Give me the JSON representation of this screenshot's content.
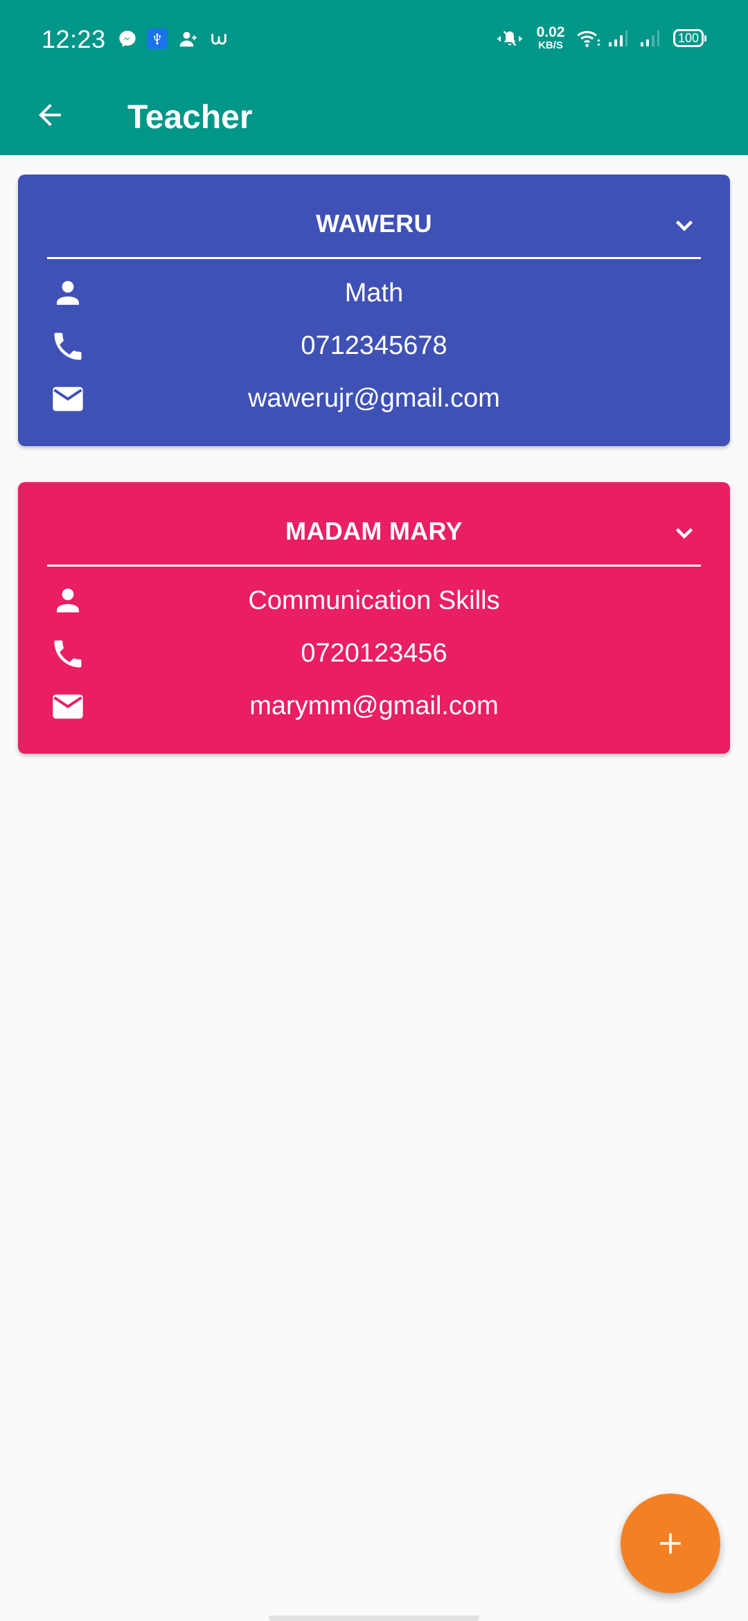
{
  "status_bar": {
    "time": "12:23",
    "notification_icons": [
      "messenger-icon",
      "usb-icon",
      "add-contact-icon",
      "app-icon"
    ],
    "net_speed_value": "0.02",
    "net_speed_unit": "KB/S",
    "system_icons": [
      "vibrate-silent-icon",
      "wifi-icon",
      "signal-icon",
      "signal-icon"
    ],
    "battery": "100"
  },
  "app_bar": {
    "title": "Teacher",
    "back_icon": "arrow-back-icon",
    "color": "#009688"
  },
  "teachers": [
    {
      "name": "WAWERU",
      "subject": "Math",
      "phone": "0712345678",
      "email": "wawerujr@gmail.com",
      "color": "#3f51b5"
    },
    {
      "name": "MADAM MARY",
      "subject": "Communication Skills",
      "phone": "0720123456",
      "email": "marymm@gmail.com",
      "color": "#e91e63"
    }
  ],
  "fab": {
    "icon": "plus-icon",
    "color": "#f48024"
  }
}
